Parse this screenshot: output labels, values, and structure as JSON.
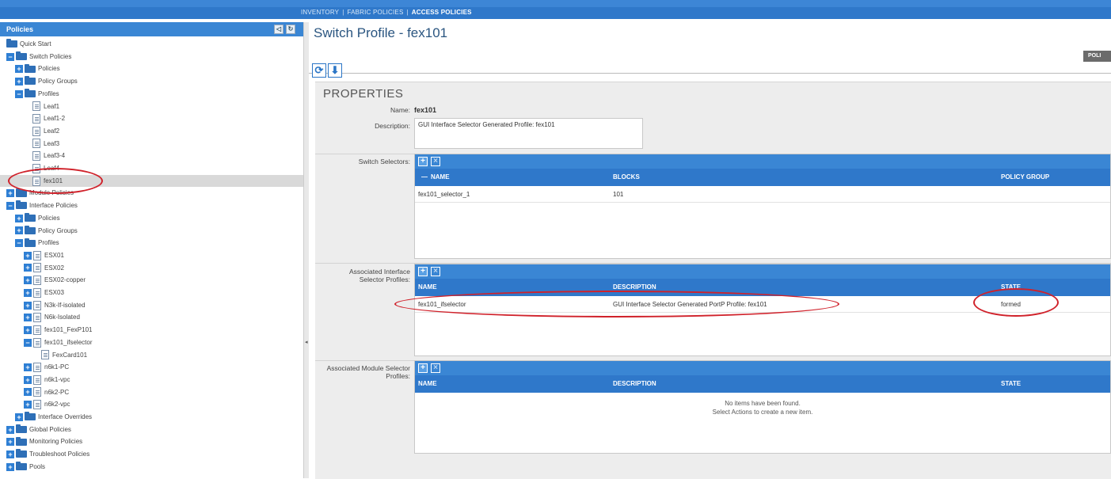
{
  "topnav": {
    "links": [
      "INVENTORY",
      "FABRIC POLICIES",
      "ACCESS POLICIES"
    ],
    "active": "ACCESS POLICIES"
  },
  "sidebar": {
    "header": "Policies",
    "tree": [
      {
        "label": "Quick Start",
        "level": 0,
        "icon": "folder",
        "toggle": "none"
      },
      {
        "label": "Switch Policies",
        "level": 0,
        "icon": "folder",
        "toggle": "minus"
      },
      {
        "label": "Policies",
        "level": 1,
        "icon": "folder",
        "toggle": "plus"
      },
      {
        "label": "Policy Groups",
        "level": 1,
        "icon": "folder",
        "toggle": "plus"
      },
      {
        "label": "Profiles",
        "level": 1,
        "icon": "folder",
        "toggle": "minus"
      },
      {
        "label": "Leaf1",
        "level": 3,
        "icon": "doc",
        "toggle": "none"
      },
      {
        "label": "Leaf1-2",
        "level": 3,
        "icon": "doc",
        "toggle": "none"
      },
      {
        "label": "Leaf2",
        "level": 3,
        "icon": "doc",
        "toggle": "none"
      },
      {
        "label": "Leaf3",
        "level": 3,
        "icon": "doc",
        "toggle": "none"
      },
      {
        "label": "Leaf3-4",
        "level": 3,
        "icon": "doc",
        "toggle": "none"
      },
      {
        "label": "Leaf4",
        "level": 3,
        "icon": "doc",
        "toggle": "none"
      },
      {
        "label": "fex101",
        "level": 3,
        "icon": "doc",
        "toggle": "none",
        "selected": true
      },
      {
        "label": "Module Policies",
        "level": 0,
        "icon": "folder",
        "toggle": "plus"
      },
      {
        "label": "Interface Policies",
        "level": 0,
        "icon": "folder",
        "toggle": "minus"
      },
      {
        "label": "Policies",
        "level": 1,
        "icon": "folder",
        "toggle": "plus"
      },
      {
        "label": "Policy Groups",
        "level": 1,
        "icon": "folder",
        "toggle": "plus"
      },
      {
        "label": "Profiles",
        "level": 1,
        "icon": "folder",
        "toggle": "minus"
      },
      {
        "label": "ESX01",
        "level": 2,
        "icon": "doc",
        "toggle": "plus"
      },
      {
        "label": "ESX02",
        "level": 2,
        "icon": "doc",
        "toggle": "plus"
      },
      {
        "label": "ESX02-copper",
        "level": 2,
        "icon": "doc",
        "toggle": "plus"
      },
      {
        "label": "ESX03",
        "level": 2,
        "icon": "doc",
        "toggle": "plus"
      },
      {
        "label": "N3k-If-isolated",
        "level": 2,
        "icon": "doc",
        "toggle": "plus"
      },
      {
        "label": "N6k-Isolated",
        "level": 2,
        "icon": "doc",
        "toggle": "plus"
      },
      {
        "label": "fex101_FexP101",
        "level": 2,
        "icon": "doc",
        "toggle": "plus"
      },
      {
        "label": "fex101_ifselector",
        "level": 2,
        "icon": "doc",
        "toggle": "minus"
      },
      {
        "label": "FexCard101",
        "level": 4,
        "icon": "doc",
        "toggle": "none"
      },
      {
        "label": "n6k1-PC",
        "level": 2,
        "icon": "doc",
        "toggle": "plus"
      },
      {
        "label": "n6k1-vpc",
        "level": 2,
        "icon": "doc",
        "toggle": "plus"
      },
      {
        "label": "n6k2-PC",
        "level": 2,
        "icon": "doc",
        "toggle": "plus"
      },
      {
        "label": "n6k2-vpc",
        "level": 2,
        "icon": "doc",
        "toggle": "plus"
      },
      {
        "label": "Interface Overrides",
        "level": 1,
        "icon": "folder",
        "toggle": "plus"
      },
      {
        "label": "Global Policies",
        "level": 0,
        "icon": "folder",
        "toggle": "plus"
      },
      {
        "label": "Monitoring Policies",
        "level": 0,
        "icon": "folder",
        "toggle": "plus"
      },
      {
        "label": "Troubleshoot Policies",
        "level": 0,
        "icon": "folder",
        "toggle": "plus"
      },
      {
        "label": "Pools",
        "level": 0,
        "icon": "folder",
        "toggle": "plus"
      }
    ]
  },
  "main": {
    "title": "Switch Profile - fex101",
    "tab_stub": "POLI",
    "properties_heading": "PROPERTIES",
    "name_label": "Name:",
    "name_value": "fex101",
    "description_label": "Description:",
    "description_value": "GUI Interface Selector Generated Profile: fex101",
    "switch_selectors": {
      "label": "Switch Selectors:",
      "columns": [
        "NAME",
        "BLOCKS",
        "POLICY GROUP"
      ],
      "rows": [
        {
          "name": "fex101_selector_1",
          "blocks": "101",
          "policy_group": ""
        }
      ]
    },
    "interface_selectors": {
      "label_line1": "Associated Interface",
      "label_line2": "Selector Profiles:",
      "columns": [
        "NAME",
        "DESCRIPTION",
        "STATE"
      ],
      "rows": [
        {
          "name": "fex101_ifselector",
          "description": "GUI Interface Selector Generated PortP Profile: fex101",
          "state": "formed"
        }
      ]
    },
    "module_selectors": {
      "label_line1": "Associated Module Selector",
      "label_line2": "Profiles:",
      "columns": [
        "NAME",
        "DESCRIPTION",
        "STATE"
      ],
      "empty_line1": "No items have been found.",
      "empty_line2": "Select Actions to create a new item."
    }
  },
  "colors": {
    "accent": "#3a86d4",
    "header_dark": "#2f78ca",
    "highlight_ring": "#d0212a"
  }
}
